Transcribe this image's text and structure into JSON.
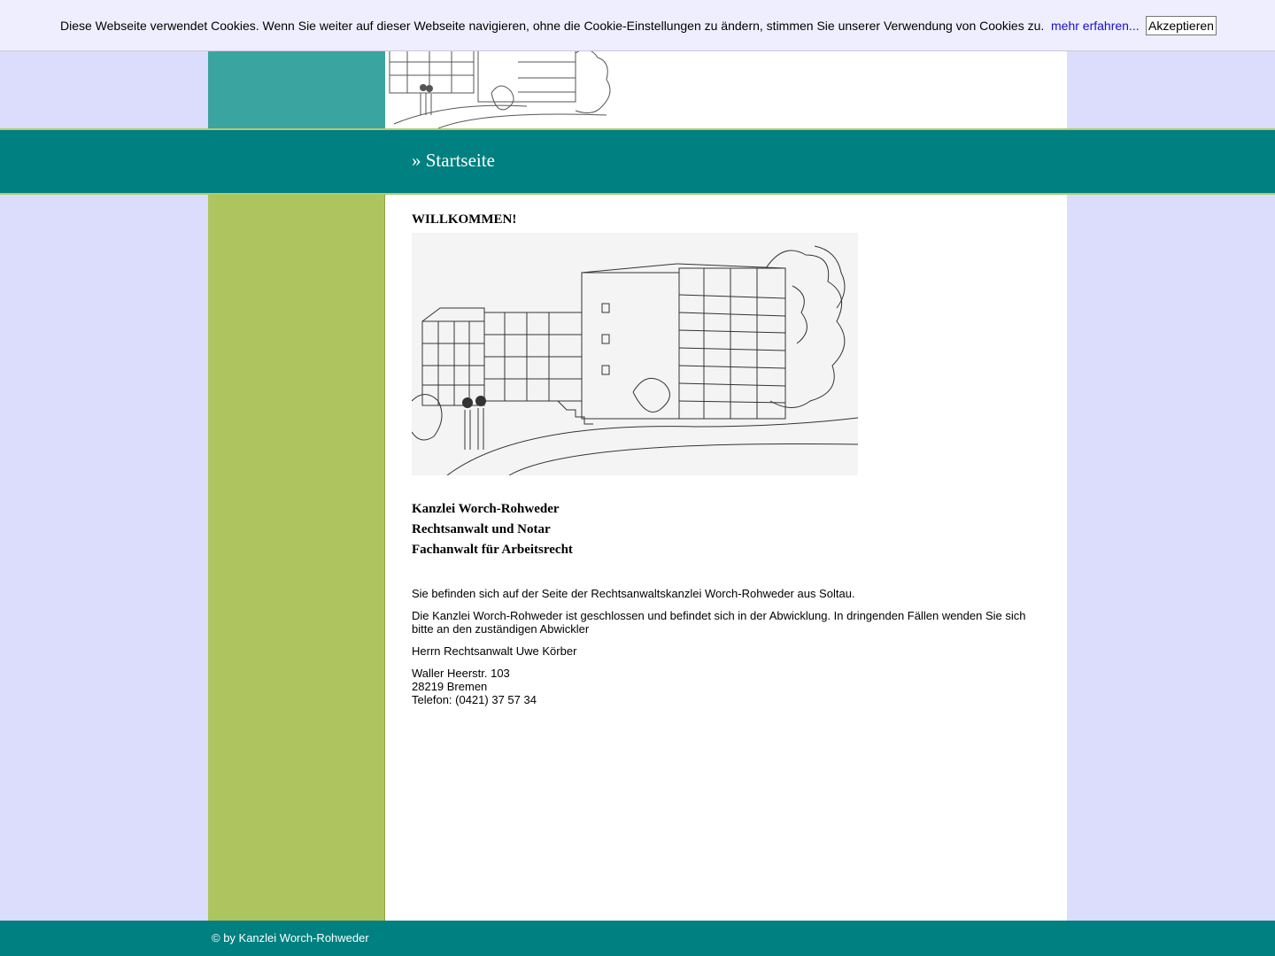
{
  "cookie_bar": {
    "message": "Diese Webseite verwendet Cookies. Wenn Sie weiter auf dieser Webseite navigieren, ohne die Cookie-Einstellungen zu ändern, stimmen Sie unserer Verwendung von Cookies zu.",
    "link_label": "mehr erfahren...",
    "accept_label": "Akzeptieren"
  },
  "nav": {
    "breadcrumb": "» Startseite"
  },
  "main": {
    "heading": "WILLKOMMEN!",
    "firm_lines": [
      "Kanzlei Worch-Rohweder",
      "Rechtsanwalt und Notar",
      "Fachanwalt für Arbeitsrecht"
    ],
    "paragraphs": [
      "Sie befinden sich auf der Seite der Rechtsanwaltskanzlei Worch-Rohweder aus Soltau.",
      "Die Kanzlei Worch-Rohweder ist geschlossen und befindet sich in der Abwicklung. In dringenden Fällen wenden Sie sich bitte an den zuständigen Abwickler",
      "Herrn Rechtsanwalt Uwe Körber"
    ],
    "address": {
      "street": "Waller Heerstr. 103",
      "city": "28219 Bremen",
      "phone": "Telefon: (0421) 37 57 34"
    }
  },
  "footer": {
    "copyright": "© by Kanzlei Worch-Rohweder"
  },
  "colors": {
    "page_bg": "#dcdcfc",
    "teal": "#008080",
    "header_teal": "#3aa4a0",
    "sidebar_green": "#aec45e",
    "link": "#1a0dcc"
  },
  "images": {
    "header": "building-sketch-header",
    "main": "building-sketch-illustration"
  }
}
